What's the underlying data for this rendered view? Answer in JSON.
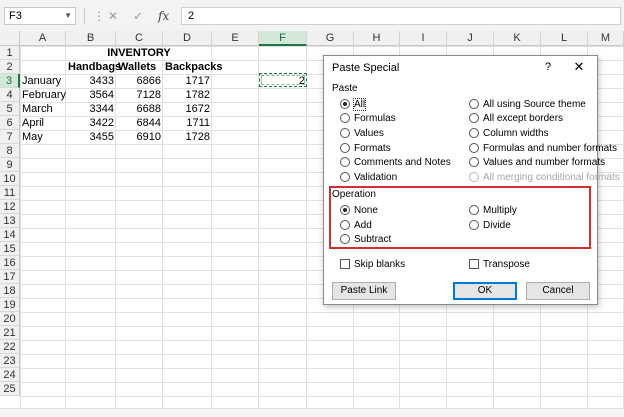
{
  "formula_bar": {
    "name_box": "F3",
    "cancel_icon": "x-icon",
    "enter_icon": "check-icon",
    "function_label": "fx",
    "value": "2"
  },
  "columns": [
    "A",
    "B",
    "C",
    "D",
    "E",
    "F",
    "G",
    "H",
    "I",
    "J",
    "K",
    "L",
    "M"
  ],
  "rows": [
    "1",
    "2",
    "3",
    "4",
    "5",
    "6",
    "7",
    "8",
    "9",
    "10",
    "11",
    "12",
    "13",
    "14",
    "15",
    "16",
    "17",
    "18",
    "19",
    "20",
    "21",
    "22",
    "23",
    "24",
    "25"
  ],
  "active_cell": {
    "column": "F",
    "row": "3"
  },
  "sheet": {
    "title": "INVENTORY",
    "headers": [
      "Handbags",
      "Wallets",
      "Backpacks"
    ],
    "data_rows": [
      {
        "month": "January",
        "values": [
          "3433",
          "6866",
          "1717"
        ]
      },
      {
        "month": "February",
        "values": [
          "3564",
          "7128",
          "1782"
        ]
      },
      {
        "month": "March",
        "values": [
          "3344",
          "6688",
          "1672"
        ]
      },
      {
        "month": "April",
        "values": [
          "3422",
          "6844",
          "1711"
        ]
      },
      {
        "month": "May",
        "values": [
          "3455",
          "6910",
          "1728"
        ]
      }
    ],
    "copied_value": "2"
  },
  "dialog": {
    "title": "Paste Special",
    "help": "?",
    "close": "✕",
    "paste_label": "Paste",
    "paste_options_left": [
      "All",
      "Formulas",
      "Values",
      "Formats",
      "Comments and Notes",
      "Validation"
    ],
    "paste_options_right": [
      "All using Source theme",
      "All except borders",
      "Column widths",
      "Formulas and number formats",
      "Values and number formats",
      "All merging conditional formats"
    ],
    "paste_selected": "All",
    "operation_label": "Operation",
    "operation_left": [
      "None",
      "Add",
      "Subtract"
    ],
    "operation_right": [
      "Multiply",
      "Divide"
    ],
    "operation_selected": "None",
    "skip_blanks": "Skip blanks",
    "transpose": "Transpose",
    "paste_link_button": "Paste Link",
    "ok_button": "OK",
    "cancel_button": "Cancel",
    "highlight_color": "#d32f2f"
  }
}
